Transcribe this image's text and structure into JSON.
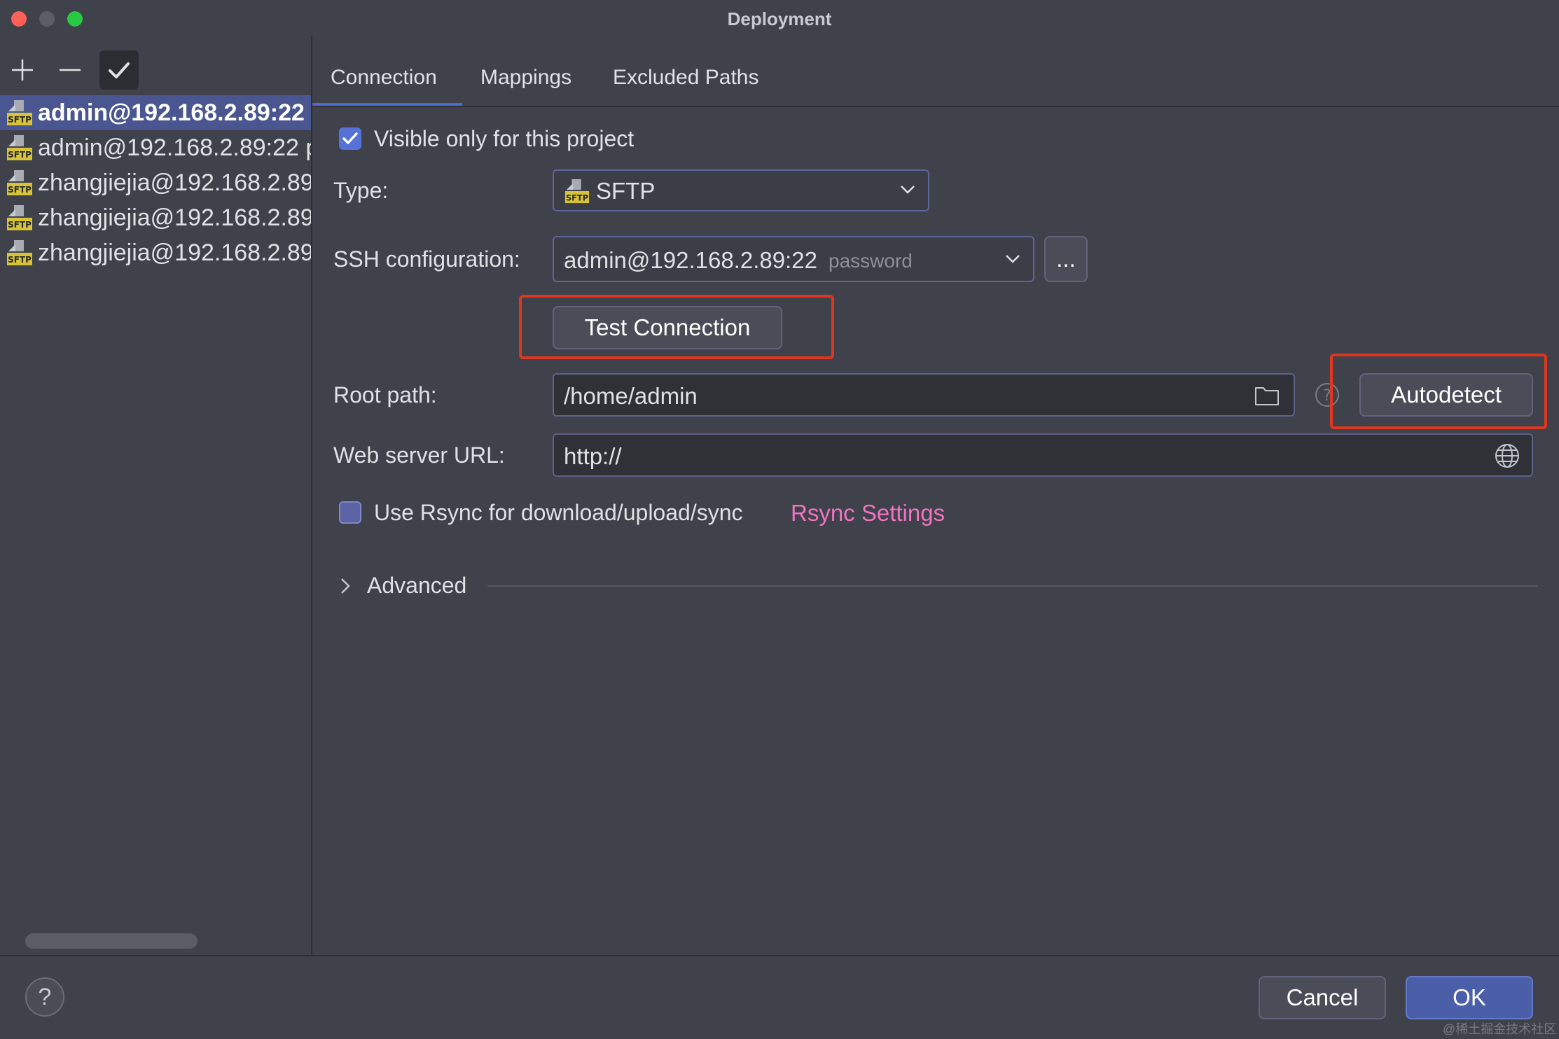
{
  "window": {
    "title": "Deployment"
  },
  "sidebar": {
    "toolbar": {
      "add": "add",
      "remove": "remove",
      "apply": "apply"
    },
    "servers": [
      {
        "label": "admin@192.168.2.89:22",
        "icon": "sftp-icon",
        "selected": true
      },
      {
        "label": "admin@192.168.2.89:22 p",
        "icon": "sftp-icon",
        "selected": false
      },
      {
        "label": "zhangjiejia@192.168.2.89",
        "icon": "sftp-icon",
        "selected": false
      },
      {
        "label": "zhangjiejia@192.168.2.89",
        "icon": "sftp-icon",
        "selected": false
      },
      {
        "label": "zhangjiejia@192.168.2.89",
        "icon": "sftp-icon",
        "selected": false
      }
    ]
  },
  "tabs": [
    {
      "label": "Connection",
      "active": true
    },
    {
      "label": "Mappings",
      "active": false
    },
    {
      "label": "Excluded Paths",
      "active": false
    }
  ],
  "connection": {
    "visible_only": {
      "label": "Visible only for this project",
      "checked": true
    },
    "type": {
      "label": "Type:",
      "value": "SFTP"
    },
    "ssh": {
      "label": "SSH configuration:",
      "value": "admin@192.168.2.89:22",
      "hint": "password",
      "more_label": "..."
    },
    "test_connection_label": "Test Connection",
    "root_path": {
      "label": "Root path:",
      "value": "/home/admin",
      "autodetect_label": "Autodetect"
    },
    "web_server_url": {
      "label": "Web server URL:",
      "value": "http://"
    },
    "rsync": {
      "label": "Use Rsync for download/upload/sync",
      "checked": false,
      "settings_link": "Rsync Settings"
    },
    "advanced_label": "Advanced"
  },
  "footer": {
    "help_label": "?",
    "cancel_label": "Cancel",
    "ok_label": "OK",
    "watermark": "@稀土掘金技术社区"
  },
  "colors": {
    "accent": "#4e6bcc",
    "selection": "#4a5690",
    "link": "#f173c0",
    "highlight_box": "#e0361f"
  }
}
